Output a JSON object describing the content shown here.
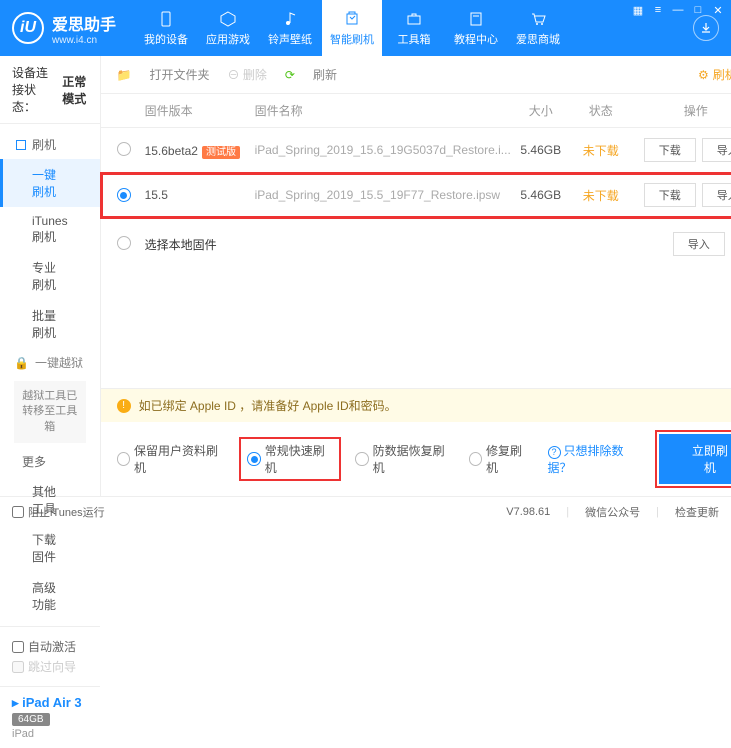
{
  "brand": {
    "name": "爱思助手",
    "url": "www.i4.cn",
    "logo": "iU"
  },
  "nav": [
    {
      "label": "我的设备",
      "icon": "phone"
    },
    {
      "label": "应用游戏",
      "icon": "apps"
    },
    {
      "label": "铃声壁纸",
      "icon": "music"
    },
    {
      "label": "智能刷机",
      "icon": "flash",
      "active": true
    },
    {
      "label": "工具箱",
      "icon": "toolbox"
    },
    {
      "label": "教程中心",
      "icon": "book"
    },
    {
      "label": "爱思商城",
      "icon": "cart"
    }
  ],
  "sidebar": {
    "conn_label": "设备连接状态：",
    "conn_value": "正常模式",
    "sec_flash": "刷机",
    "items": [
      "一键刷机",
      "iTunes刷机",
      "专业刷机",
      "批量刷机"
    ],
    "sec_jail": "一键越狱",
    "jail_note": "越狱工具已转移至工具箱",
    "sec_more": "更多",
    "more_items": [
      "其他工具",
      "下载固件",
      "高级功能"
    ],
    "auto_activate": "自动激活",
    "skip_guide": "跳过向导",
    "device": {
      "name": "iPad Air 3",
      "cap": "64GB",
      "type": "iPad"
    }
  },
  "toolbar": {
    "open": "打开文件夹",
    "delete": "删除",
    "refresh": "刷新",
    "settings": "刷机设置"
  },
  "table": {
    "head": {
      "ver": "固件版本",
      "name": "固件名称",
      "size": "大小",
      "status": "状态",
      "ops": "操作"
    },
    "rows": [
      {
        "ver": "15.6beta2",
        "beta": "测试版",
        "name": "iPad_Spring_2019_15.6_19G5037d_Restore.i...",
        "size": "5.46GB",
        "status": "未下载",
        "selected": false
      },
      {
        "ver": "15.5",
        "name": "iPad_Spring_2019_15.5_19F77_Restore.ipsw",
        "size": "5.46GB",
        "status": "未下载",
        "selected": true
      }
    ],
    "local": "选择本地固件",
    "btn_dl": "下载",
    "btn_imp": "导入"
  },
  "warning": "如已绑定 Apple ID ，请准备好 Apple ID和密码。",
  "modes": {
    "keep": "保留用户资料刷机",
    "normal": "常规快速刷机",
    "antirec": "防数据恢复刷机",
    "repair": "修复刷机",
    "exclude": "只想排除数据？",
    "go": "立即刷机"
  },
  "status": {
    "block": "阻止iTunes运行",
    "ver": "V7.98.61",
    "wechat": "微信公众号",
    "check": "检查更新"
  }
}
